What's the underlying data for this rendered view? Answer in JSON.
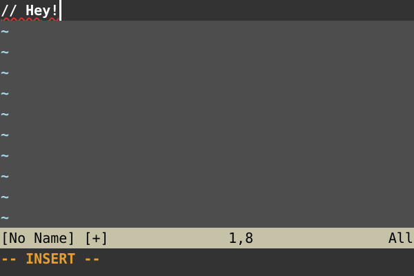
{
  "editor": {
    "line_1_text": "// Hey!",
    "tilde_marker": "~"
  },
  "statusline": {
    "buffer_name": "[No Name] [+]",
    "cursor_position": "1,8",
    "scroll_position": "All"
  },
  "cmdline": {
    "mode": "-- INSERT --"
  },
  "colors": {
    "background": "#333333",
    "buffer_background": "#4d4d4d",
    "tilde": "#a5d7e8",
    "statusline_bg": "#c5c2a7",
    "mode_text": "#e7a030",
    "spell_error": "#e03030"
  }
}
